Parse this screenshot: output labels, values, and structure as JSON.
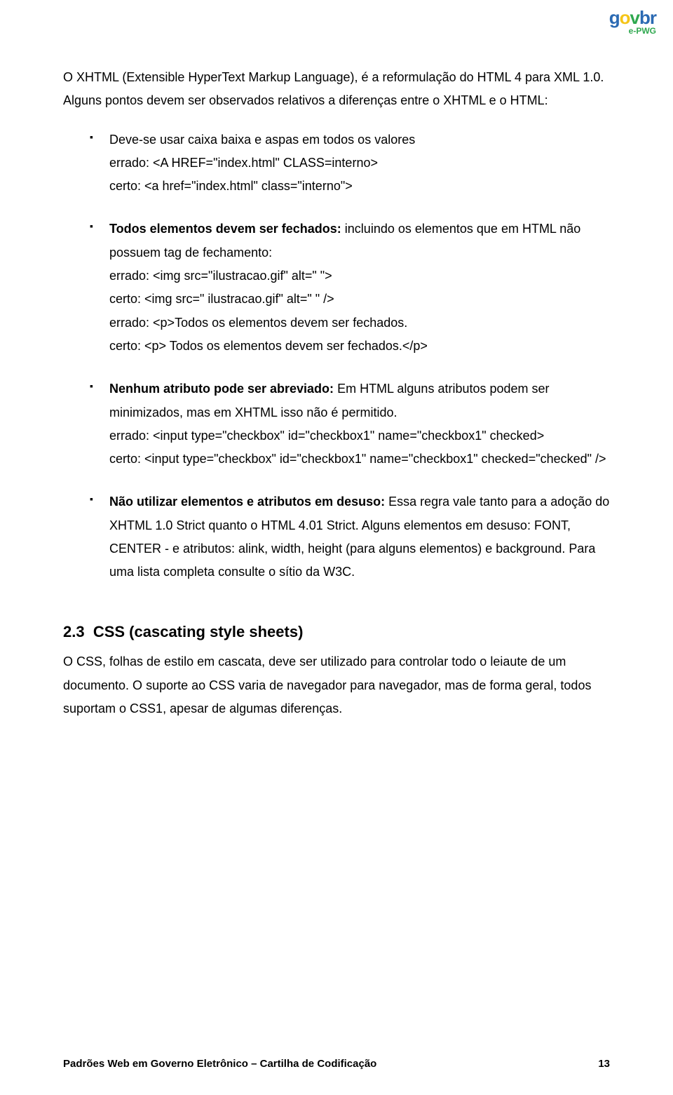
{
  "logo": {
    "text": "govbr",
    "sub": "e-PWG"
  },
  "intro": "O XHTML (Extensible HyperText Markup Language), é a reformulação do HTML 4 para XML 1.0. Alguns pontos devem ser observados relativos a diferenças entre o XHTML e o HTML:",
  "rules": [
    {
      "title": "Deve-se usar caixa baixa e aspas em todos os valores",
      "lines": [
        "errado: <A HREF=\"index.html\" CLASS=interno>",
        "certo: <a href=\"index.html\" class=\"interno\">"
      ]
    },
    {
      "title": "Todos elementos devem ser fechados:",
      "title_rest": " incluindo os elementos que em HTML não possuem tag de fechamento:",
      "lines": [
        "errado: <img src=\"ilustracao.gif\" alt=\" \">",
        "certo:   <img src=\" ilustracao.gif\" alt=\" \" />",
        "",
        "errado: <p>Todos os elementos devem ser fechados.",
        "certo:   <p> Todos os elementos devem ser fechados.</p>"
      ]
    },
    {
      "title": "Nenhum atributo pode ser abreviado:",
      "title_rest": " Em HTML alguns atributos podem ser minimizados, mas em XHTML isso não é permitido.",
      "lines": [
        "errado: <input type=\"checkbox\" id=\"checkbox1\" name=\"checkbox1\" checked>",
        "certo:   <input type=\"checkbox\" id=\"checkbox1\" name=\"checkbox1\" checked=\"checked\" />"
      ]
    },
    {
      "title": "Não utilizar elementos e atributos em desuso:",
      "title_rest": " Essa regra vale tanto para a adoção do XHTML 1.0 Strict quanto o HTML 4.01 Strict.  Alguns elementos em desuso: FONT, CENTER - e atributos: alink, width, height (para alguns elementos) e background. Para uma lista completa consulte o sítio da W3C."
    }
  ],
  "section": {
    "number": "2.3",
    "title": "CSS (cascating style sheets)",
    "body": "O CSS, folhas de estilo em cascata, deve ser utilizado para controlar todo o leiaute de um documento. O suporte ao CSS varia de navegador para navegador, mas de forma geral, todos suportam o CSS1, apesar de algumas diferenças."
  },
  "footer": {
    "left": "Padrões Web em Governo Eletrônico – Cartilha de Codificação",
    "right": "13"
  }
}
